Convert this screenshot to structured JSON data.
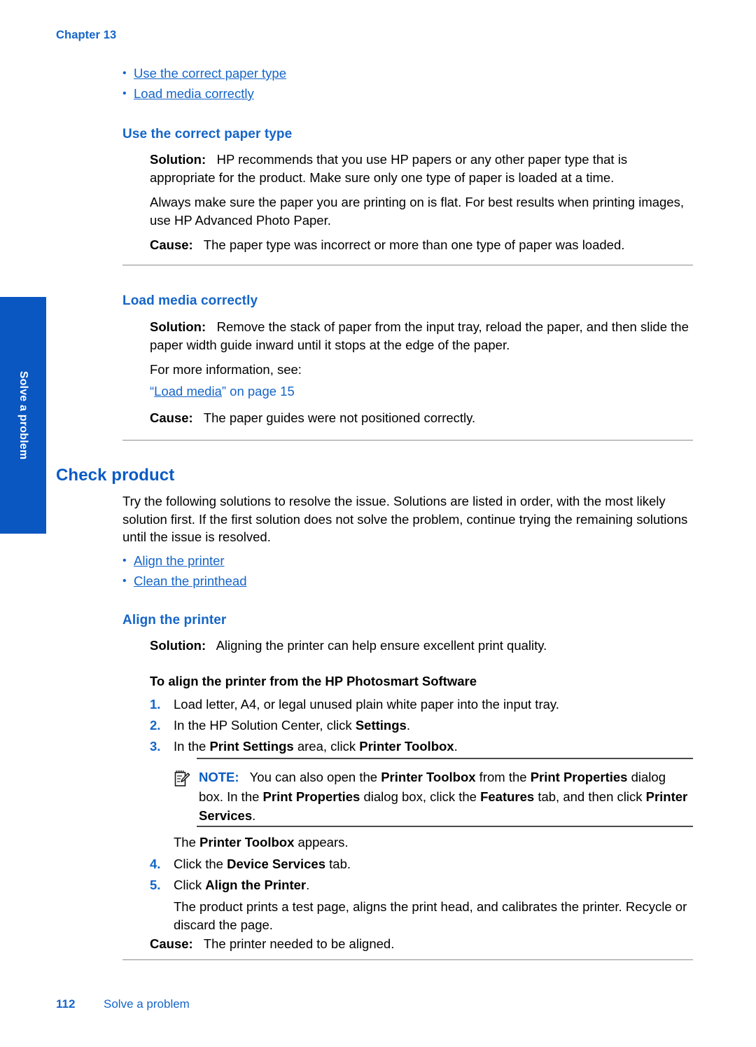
{
  "page": {
    "chapter_header": "Chapter 13",
    "side_tab_label": "Solve a problem",
    "footer_page_number": "112",
    "footer_section": "Solve a problem",
    "accent_blue": "#1565c8",
    "heading_blue": "#0a5bc4",
    "tab_blue": "#0a57c2",
    "rule_gray": "#8c8c8c"
  },
  "top_links": [
    {
      "label": "Use the correct paper type"
    },
    {
      "label": "Load media correctly"
    }
  ],
  "sections": [
    {
      "id": "use-correct-paper-type",
      "heading": "Use the correct paper type",
      "solution_label": "Solution:",
      "solution_text": "HP recommends that you use HP papers or any other paper type that is appropriate for the product. Make sure only one type of paper is loaded at a time.",
      "extra_paragraph": "Always make sure the paper you are printing on is flat. For best results when printing images, use HP Advanced Photo Paper.",
      "cause_label": "Cause:",
      "cause_text": "The paper type was incorrect or more than one type of paper was loaded."
    },
    {
      "id": "load-media-correctly",
      "heading": "Load media correctly",
      "solution_label": "Solution:",
      "solution_text": "Remove the stack of paper from the input tray, reload the paper, and then slide the paper width guide inward until it stops at the edge of the paper.",
      "more_info_text": "For more information, see:",
      "xref_quote_open": "“",
      "xref_link": "Load media",
      "xref_quote_close": "”",
      "xref_tail": " on page 15",
      "cause_label": "Cause:",
      "cause_text": "The paper guides were not positioned correctly."
    }
  ],
  "check_product": {
    "heading": "Check product",
    "intro": "Try the following solutions to resolve the issue. Solutions are listed in order, with the most likely solution first. If the first solution does not solve the problem, continue trying the remaining solutions until the issue is resolved.",
    "links": [
      {
        "label": "Align the printer"
      },
      {
        "label": "Clean the printhead"
      }
    ]
  },
  "align_printer": {
    "heading": "Align the printer",
    "solution_label": "Solution:",
    "solution_text": "Aligning the printer can help ensure excellent print quality.",
    "procedure_heading": "To align the printer from the HP Photosmart Software",
    "steps": [
      {
        "num": "1.",
        "parts": [
          {
            "t": "Load letter, A4, or legal unused plain white paper into the input tray.",
            "bold": false
          }
        ]
      },
      {
        "num": "2.",
        "parts": [
          {
            "t": "In the HP Solution Center, click ",
            "bold": false
          },
          {
            "t": "Settings",
            "bold": true
          },
          {
            "t": ".",
            "bold": false
          }
        ]
      },
      {
        "num": "3.",
        "parts": [
          {
            "t": "In the ",
            "bold": false
          },
          {
            "t": "Print Settings",
            "bold": true
          },
          {
            "t": " area, click ",
            "bold": false
          },
          {
            "t": "Printer Toolbox",
            "bold": true
          },
          {
            "t": ".",
            "bold": false
          }
        ]
      }
    ],
    "note": {
      "icon": "note-pencil-icon",
      "label": "NOTE:",
      "parts": [
        {
          "t": "You can also open the ",
          "bold": false
        },
        {
          "t": "Printer Toolbox",
          "bold": true
        },
        {
          "t": " from the ",
          "bold": false
        },
        {
          "t": "Print Properties",
          "bold": true
        },
        {
          "t": " dialog box. In the ",
          "bold": false
        },
        {
          "t": "Print Properties",
          "bold": true
        },
        {
          "t": " dialog box, click the ",
          "bold": false
        },
        {
          "t": "Features",
          "bold": true
        },
        {
          "t": " tab, and then click ",
          "bold": false
        },
        {
          "t": "Printer Services",
          "bold": true
        },
        {
          "t": ".",
          "bold": false
        }
      ]
    },
    "after_note": {
      "parts": [
        {
          "t": "The ",
          "bold": false
        },
        {
          "t": "Printer Toolbox",
          "bold": true
        },
        {
          "t": " appears.",
          "bold": false
        }
      ]
    },
    "steps_tail": [
      {
        "num": "4.",
        "parts": [
          {
            "t": "Click the ",
            "bold": false
          },
          {
            "t": "Device Services",
            "bold": true
          },
          {
            "t": " tab.",
            "bold": false
          }
        ]
      },
      {
        "num": "5.",
        "parts": [
          {
            "t": "Click ",
            "bold": false
          },
          {
            "t": "Align the Printer",
            "bold": true
          },
          {
            "t": ".",
            "bold": false
          }
        ]
      }
    ],
    "result_text": "The product prints a test page, aligns the print head, and calibrates the printer. Recycle or discard the page.",
    "cause_label": "Cause:",
    "cause_text": "The printer needed to be aligned."
  }
}
